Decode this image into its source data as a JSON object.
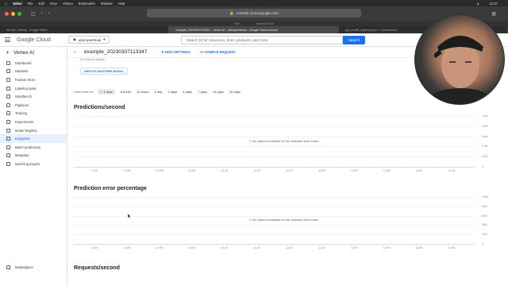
{
  "menubar": {
    "app": "Safari",
    "items": [
      "File",
      "Edit",
      "View",
      "History",
      "Bookmarks",
      "Window",
      "Help"
    ],
    "clock": "12:47"
  },
  "browser": {
    "url": "console.cloud.google.com",
    "favorites": [
      "F&F",
      "Yandex Cloud"
    ],
    "tabs": [
      "4B-Gen_Udemy - Google Slides",
      "example_20230307113347 – Vertex AI – udemyvertexai – Google Cloud console",
      "gcp_model_registry.ipynb – Colaboratory"
    ],
    "active_tab": 1
  },
  "header": {
    "logo": "Google Cloud",
    "project": "udemyvertexai",
    "search_placeholder": "Search (/) for resources, docs, products, and more",
    "search_button": "Search"
  },
  "sidebar": {
    "title": "Vertex AI",
    "items": [
      {
        "label": "Dashboard",
        "icon": "dashboard-icon"
      },
      {
        "label": "Datasets",
        "icon": "datasets-icon"
      },
      {
        "label": "Feature Store",
        "icon": "feature-store-icon"
      },
      {
        "label": "Labeling tasks",
        "icon": "labeling-icon"
      },
      {
        "label": "Workbench",
        "icon": "workbench-icon"
      },
      {
        "label": "Pipelines",
        "icon": "pipelines-icon"
      },
      {
        "label": "Training",
        "icon": "training-icon"
      },
      {
        "label": "Experiments",
        "icon": "experiments-icon"
      },
      {
        "label": "Model Registry",
        "icon": "model-registry-icon"
      },
      {
        "label": "Endpoints",
        "icon": "endpoints-icon"
      },
      {
        "label": "Batch predictions",
        "icon": "batch-icon"
      },
      {
        "label": "Metadata",
        "icon": "metadata-icon"
      },
      {
        "label": "Matching Engine",
        "icon": "matching-icon"
      }
    ],
    "active": 9,
    "bottom": "Marketplace"
  },
  "page": {
    "title": "example_20230307113347",
    "edit_settings": "EDIT SETTINGS",
    "sample_request": "SAMPLE REQUEST",
    "clipped_text": "No rows to display",
    "deploy_button": "DEPLOY ANOTHER MODEL",
    "interval_label": "Chart interval:",
    "intervals": [
      "1 hour",
      "6 hours",
      "12 hours",
      "1 day",
      "2 days",
      "4 days",
      "7 days",
      "14 days",
      "30 days"
    ],
    "selected_interval": 0
  },
  "charts": [
    {
      "title": "Predictions/second",
      "empty_message": "No data is available for the selected time frame.",
      "y_ticks": [
        "1.0/s",
        "0.8/s",
        "0.6/s",
        "0.4/s",
        "0.2/s",
        "0"
      ],
      "x_ticks": [
        "11:50",
        "11:55",
        "12 PM",
        "12:05",
        "12:10",
        "12:15",
        "12:20",
        "12:25",
        "12:30",
        "12:35",
        "12:40",
        "12:45"
      ]
    },
    {
      "title": "Prediction error percentage",
      "empty_message": "No data is available for the selected time frame.",
      "y_ticks": [
        "100%",
        "80%",
        "60%",
        "40%",
        "20%",
        "0"
      ],
      "x_ticks": [
        "11:50",
        "11:55",
        "12 PM",
        "12:05",
        "12:10",
        "12:15",
        "12:20",
        "12:25",
        "12:30",
        "12:35",
        "12:40",
        "12:45"
      ]
    },
    {
      "title": "Requests/second"
    }
  ]
}
